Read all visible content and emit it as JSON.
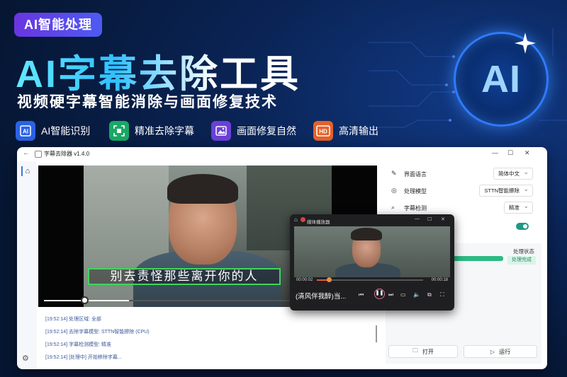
{
  "promo": {
    "badge": "AI智能处理",
    "headline": "AI字幕去除工具",
    "subline": "视频硬字幕智能消除与画面修复技术",
    "logo_text": "AI",
    "features": [
      {
        "icon": "ai-chip-icon",
        "label": "AI智能识别",
        "color": "#2b63e6"
      },
      {
        "icon": "focus-frame-icon",
        "label": "精准去除字幕",
        "color": "#19a866"
      },
      {
        "icon": "image-icon",
        "label": "画面修复自然",
        "color": "#6b3fd8"
      },
      {
        "icon": "hd-icon",
        "label": "高清输出",
        "color": "#e2622b"
      }
    ],
    "accent_colors": {
      "cyan": "#63e9ff",
      "purple": "#6a35e0",
      "blue": "#2f7bff"
    }
  },
  "app": {
    "title": "字幕去除器 v1.4.0",
    "window_controls": [
      "—",
      "☐",
      "✕"
    ],
    "video": {
      "subtitle_text": "别去责怪那些离开你的人",
      "progress": 0.14
    },
    "log": [
      "[19:52:14] 处理区域: 全部",
      "[19:52:14] 去除字幕模型: STTN智能擦除 (CPU)",
      "[19:52:14] 字幕检测模型: 精准",
      "[19:52:14] [处理中] 开始移除字幕..."
    ],
    "settings": [
      {
        "icon": "translate-icon",
        "label": "界面语言",
        "value": "简体中文"
      },
      {
        "icon": "globe-icon",
        "label": "处理模型",
        "value": "STTN智能擦除"
      },
      {
        "icon": "search-icon",
        "label": "字幕检测",
        "value": "精准"
      }
    ],
    "toggle_on": true,
    "status": {
      "label": "处理状态",
      "done": "处理完成",
      "progress": 1.0
    },
    "buttons": {
      "open": "打开",
      "run": "运行"
    }
  },
  "player": {
    "title": "媒体播放器",
    "time_current": "00:00:02",
    "time_total": "00:00:18",
    "progress": 0.11,
    "caption": "(清风伴我醉)当..."
  }
}
